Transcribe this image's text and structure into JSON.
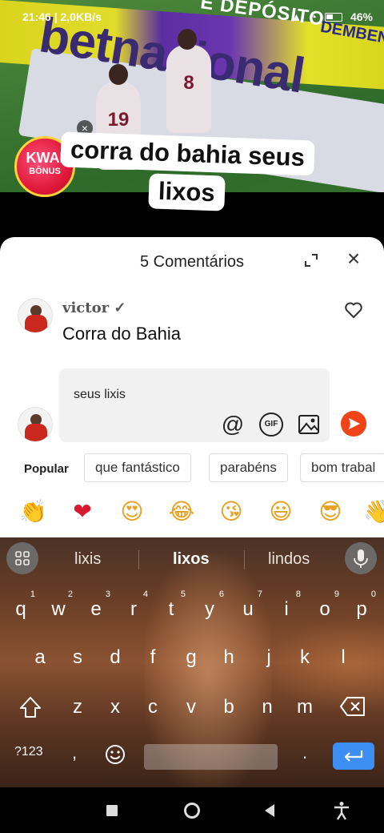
{
  "status_bar": {
    "left": "21:46 | 2,0KB/s",
    "battery": "46%"
  },
  "video": {
    "billboard_text": "E DEPÓSITO",
    "billboard_text2": "DEMBEN",
    "banner_text": "betnacional",
    "players": [
      {
        "number": "19"
      },
      {
        "number": "8"
      }
    ],
    "badge": {
      "line1": "KWAI",
      "line2": "BÔNUS"
    },
    "caption": {
      "line1": "corra do bahia seus",
      "line2": "lixos"
    }
  },
  "comments": {
    "title": "5 Comentários",
    "items": [
      {
        "user": "victor ✓",
        "text": "Corra do Bahia"
      }
    ]
  },
  "composer": {
    "input_value": "seus lixis",
    "quick_replies_label": "Popular",
    "quick_replies": [
      "que fantástico",
      "parabéns",
      "bom trabal"
    ],
    "emojis": [
      "👏",
      "❤",
      "😍",
      "😂",
      "😘",
      "😃",
      "😎",
      "👋"
    ]
  },
  "keyboard": {
    "suggestions": [
      "lixis",
      "lixos",
      "lindos"
    ],
    "row1": [
      {
        "key": "q",
        "num": "1"
      },
      {
        "key": "w",
        "num": "2"
      },
      {
        "key": "e",
        "num": "3"
      },
      {
        "key": "r",
        "num": "4"
      },
      {
        "key": "t",
        "num": "5"
      },
      {
        "key": "y",
        "num": "6"
      },
      {
        "key": "u",
        "num": "7"
      },
      {
        "key": "i",
        "num": "8"
      },
      {
        "key": "o",
        "num": "9"
      },
      {
        "key": "p",
        "num": "0"
      }
    ],
    "row2": [
      "a",
      "s",
      "d",
      "f",
      "g",
      "h",
      "j",
      "k",
      "l"
    ],
    "row3": [
      "z",
      "x",
      "c",
      "v",
      "b",
      "n",
      "m"
    ],
    "symbols_label": "?123",
    "comma": ",",
    "period": "."
  },
  "colors": {
    "accent": "#f04418",
    "enter": "#3d8ef3"
  }
}
